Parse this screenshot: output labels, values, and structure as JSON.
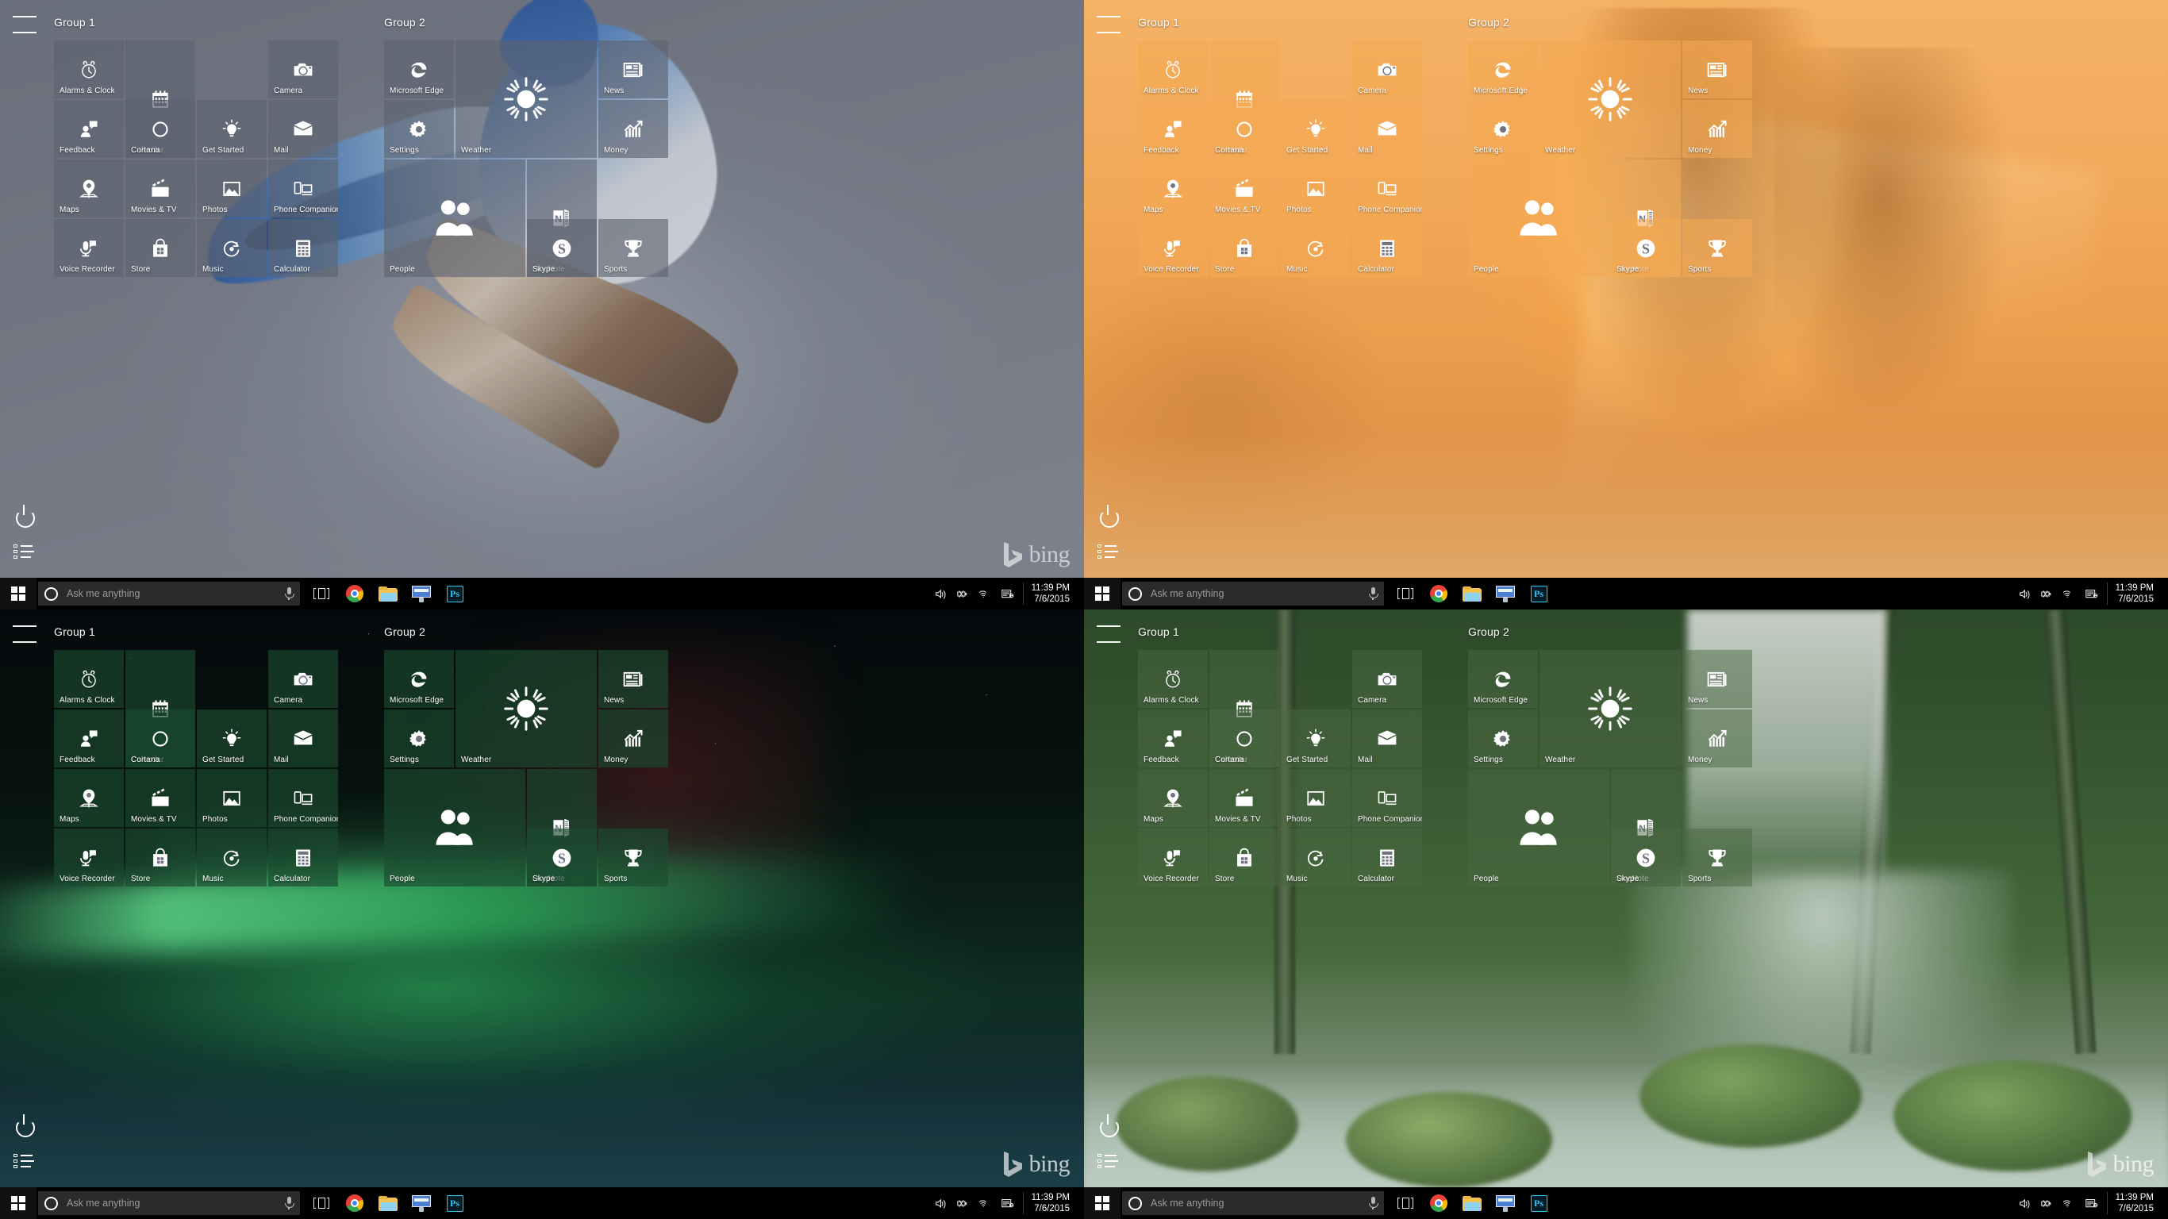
{
  "shell": {
    "hamburger_label": "Start menu hamburger",
    "power_label": "Power",
    "all_apps_label": "All apps"
  },
  "taskbar": {
    "start_label": "Start",
    "search_placeholder": "Ask me anything",
    "search_value": "",
    "mic_label": "Cortana microphone",
    "pinned": [
      {
        "name": "task-view",
        "label": "Task View"
      },
      {
        "name": "google-chrome",
        "label": "Google Chrome"
      },
      {
        "name": "file-explorer",
        "label": "File Explorer"
      },
      {
        "name": "remote-desktop",
        "label": "Remote Desktop"
      },
      {
        "name": "photoshop",
        "label": "Ps"
      }
    ],
    "tray": [
      {
        "name": "volume",
        "label": "Speakers"
      },
      {
        "name": "battery",
        "label": "Battery"
      },
      {
        "name": "wifi",
        "label": "Network"
      },
      {
        "name": "action-center",
        "label": "Action Center"
      }
    ],
    "clock_time": "11:39 PM",
    "clock_date": "7/6/2015"
  },
  "watermark": {
    "text": "bing"
  },
  "groups": [
    {
      "title": "Group 1",
      "tiles": [
        {
          "label": "Alarms & Clock",
          "icon": "alarm-clock-icon",
          "w": 1,
          "h": 1
        },
        {
          "label": "Calendar",
          "icon": "calendar-icon",
          "w": 2,
          "h": 1
        },
        {
          "label": "Camera",
          "icon": "camera-icon",
          "w": 1,
          "h": 1
        },
        {
          "label": "Feedback",
          "icon": "feedback-icon",
          "w": 1,
          "h": 1
        },
        {
          "label": "Cortana",
          "icon": "cortana-ring-icon",
          "w": 1,
          "h": 1
        },
        {
          "label": "Get Started",
          "icon": "lightbulb-icon",
          "w": 1,
          "h": 1
        },
        {
          "label": "Mail",
          "icon": "envelope-icon",
          "w": 1,
          "h": 1
        },
        {
          "label": "Maps",
          "icon": "map-pin-icon",
          "w": 1,
          "h": 1
        },
        {
          "label": "Movies & TV",
          "icon": "clapperboard-icon",
          "w": 1,
          "h": 1
        },
        {
          "label": "Photos",
          "icon": "photo-mountain-icon",
          "w": 1,
          "h": 1
        },
        {
          "label": "Phone Companion",
          "icon": "phone-laptop-icon",
          "w": 1,
          "h": 1
        },
        {
          "label": "Voice Recorder",
          "icon": "microphone-icon",
          "w": 1,
          "h": 1
        },
        {
          "label": "Store",
          "icon": "shopping-bag-icon",
          "w": 1,
          "h": 1
        },
        {
          "label": "Music",
          "icon": "music-disc-icon",
          "w": 1,
          "h": 1
        },
        {
          "label": "Calculator",
          "icon": "calculator-icon",
          "w": 1,
          "h": 1
        }
      ]
    },
    {
      "title": "Group 2",
      "tiles": [
        {
          "label": "Microsoft Edge",
          "icon": "edge-icon",
          "w": 1,
          "h": 1
        },
        {
          "label": "Weather",
          "icon": "sun-icon",
          "w": 2,
          "h": 2
        },
        {
          "label": "News",
          "icon": "news-icon",
          "w": 1,
          "h": 1
        },
        {
          "label": "Settings",
          "icon": "gear-icon",
          "w": 1,
          "h": 1
        },
        {
          "label": "Money",
          "icon": "chart-up-icon",
          "w": 1,
          "h": 1
        },
        {
          "label": "People",
          "icon": "people-icon",
          "w": 2,
          "h": 2
        },
        {
          "label": "OneNote",
          "icon": "onenote-icon",
          "w": 2,
          "h": 1
        },
        {
          "label": "Skype",
          "icon": "skype-icon",
          "w": 1,
          "h": 1
        },
        {
          "label": "Sports",
          "icon": "trophy-icon",
          "w": 1,
          "h": 1
        }
      ]
    }
  ],
  "screens": [
    {
      "id": "bluejay",
      "name": "blue-jay-winter",
      "wallpaper": "wp-bluejay",
      "accent": "#5a6070",
      "tile_rgba": "rgba(92,98,112,0.62)",
      "tint": "rgba(96,100,112,0.30)",
      "bing_visible": true,
      "bing_theme": "dark"
    },
    {
      "id": "sunrise",
      "name": "orange-sunrise-forest",
      "wallpaper": "wp-sunrise",
      "accent": "#f0a24f",
      "tile_rgba": "rgba(245,168,82,0.58)",
      "tint": "rgba(250,190,120,0.22)",
      "bing_visible": false,
      "bing_theme": "dark"
    },
    {
      "id": "aurora",
      "name": "green-aurora",
      "wallpaper": "wp-aurora",
      "accent": "#1c4d33",
      "tile_rgba": "rgba(27,74,47,0.66)",
      "tint": "rgba(10,30,20,0.18)",
      "bing_visible": true,
      "bing_theme": "light"
    },
    {
      "id": "forest",
      "name": "green-rainforest",
      "wallpaper": "wp-forest",
      "accent": "#4a6b43",
      "tile_rgba": "rgba(74,104,66,0.50)",
      "tint": "rgba(40,70,40,0.14)",
      "bing_visible": true,
      "bing_theme": "light"
    }
  ]
}
